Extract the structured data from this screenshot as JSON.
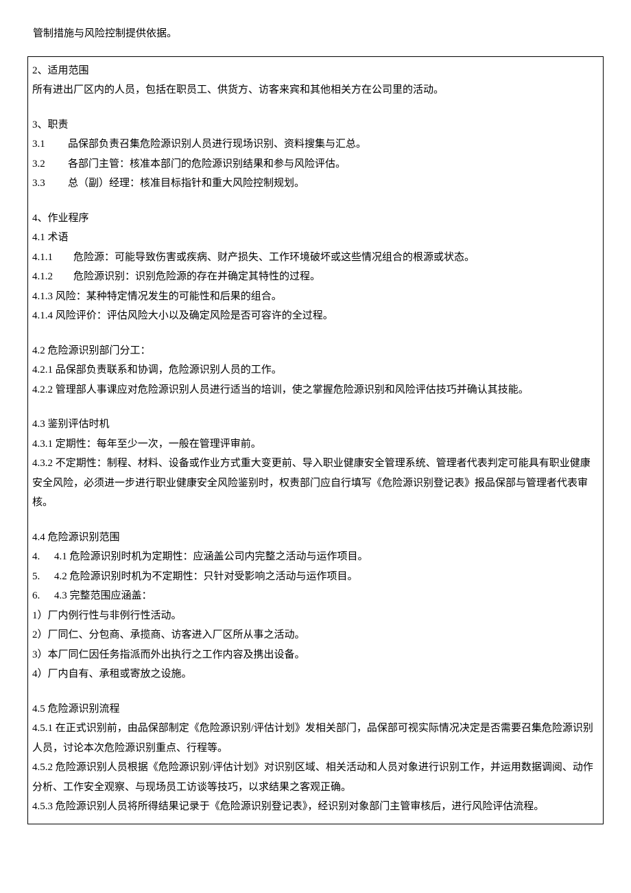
{
  "top_text": "管制措施与风险控制提供依据。",
  "s2": {
    "title": "2、适用范围",
    "body": "所有进出厂区内的人员，包括在职员工、供货方、访客来宾和其他相关方在公司里的活动。"
  },
  "s3": {
    "title": "3、职责",
    "items": [
      {
        "num": "3.1",
        "text": "品保部负责召集危险源识别人员进行现场识别、资料搜集与汇总。"
      },
      {
        "num": "3.2",
        "text": "各部门主管：核准本部门的危险源识别结果和参与风险评估。"
      },
      {
        "num": "3.3",
        "text": "总（副）经理：核准目标指针和重大风险控制规划。"
      }
    ]
  },
  "s4": {
    "title": "4、作业程序",
    "s41": {
      "title": "4.1 术语",
      "items": [
        {
          "num": "4.1.1",
          "text": "危险源：可能导致伤害或疾病、财产损失、工作环境破坏或这些情况组合的根源或状态。"
        },
        {
          "num": "4.1.2",
          "text": "危险源识别：识别危险源的存在并确定其特性的过程。"
        }
      ],
      "inline": [
        "4.1.3 风险：某种特定情况发生的可能性和后果的组合。",
        "4.1.4 风险评价：评估风险大小以及确定风险是否可容许的全过程。"
      ]
    },
    "s42": {
      "title": "4.2 危险源识别部门分工：",
      "items": [
        "4.2.1 品保部负责联系和协调，危险源识别人员的工作。",
        "4.2.2 管理部人事课应对危险源识别人员进行适当的培训，使之掌握危险源识别和风险评估技巧并确认其技能。"
      ]
    },
    "s43": {
      "title": "4.3 鉴别评估时机",
      "items": [
        "4.3.1 定期性：每年至少一次，一般在管理评审前。",
        "4.3.2 不定期性：制程、材料、设备或作业方式重大变更前、导入职业健康安全管理系统、管理者代表判定可能具有职业健康安全风险，必须进一步进行职业健康安全风险鉴别时，权责部门应自行填写《危险源识别登记表》报品保部与管理者代表审核。"
      ]
    },
    "s44": {
      "title": "4.4 危险源识别范围",
      "ol": [
        {
          "num": "4.",
          "text": "4.1 危险源识别时机为定期性：应涵盖公司内完整之活动与运作项目。"
        },
        {
          "num": "5.",
          "text": "4.2 危险源识别时机为不定期性：只针对受影响之活动与运作项目。"
        },
        {
          "num": "6.",
          "text": "4.3 完整范围应涵盖："
        }
      ],
      "sub": [
        "1）厂内例行性与非例行性活动。",
        "2）厂同仁、分包商、承揽商、访客进入厂区所从事之活动。",
        "3）本厂同仁因任务指派而外出执行之工作内容及携出设备。",
        "4）厂内自有、承租或寄放之设施。"
      ]
    },
    "s45": {
      "title": "4.5 危险源识别流程",
      "items": [
        "4.5.1 在正式识别前，由品保部制定《危险源识别/评估计划》发相关部门，品保部可视实际情况决定是否需要召集危险源识别人员，讨论本次危险源识别重点、行程等。",
        "4.5.2 危险源识别人员根据《危险源识别/评估计划》对识别区域、相关活动和人员对象进行识别工作，并运用数据调阅、动作分析、工作安全观察、与现场员工访谈等技巧，以求结果之客观正确。",
        "4.5.3 危险源识别人员将所得结果记录于《危险源识别登记表》，经识别对象部门主管审核后，进行风险评估流程。"
      ]
    }
  }
}
